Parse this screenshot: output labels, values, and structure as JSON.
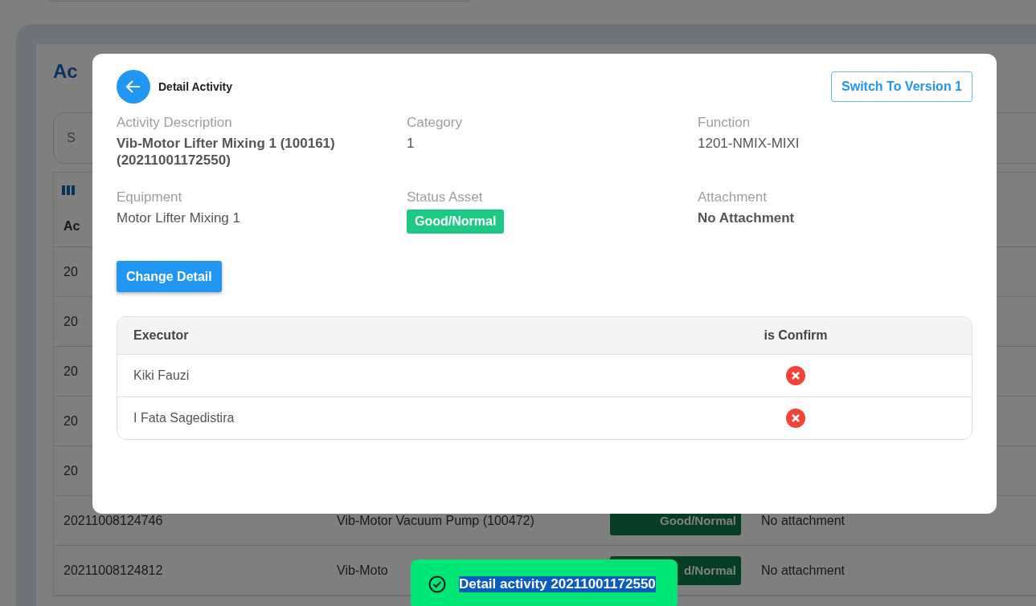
{
  "background": {
    "title": "Ac",
    "search": {
      "placeholder": "S"
    },
    "table": {
      "columns": [
        "Ac"
      ],
      "rows": [
        {
          "id": "20"
        },
        {
          "id": "20"
        },
        {
          "id": "20"
        },
        {
          "id": "20"
        },
        {
          "id": "20"
        },
        {
          "id": "20211008124746",
          "description": "Vib-Motor Vacuum Pump (100472)",
          "status": "Good/Normal",
          "attachment": "No attachment"
        },
        {
          "id": "20211008124812",
          "description": "Vib-Moto",
          "status": "d/Normal",
          "attachment": "No attachment"
        }
      ]
    }
  },
  "modal": {
    "title": "Detail Activity",
    "switch_button": "Switch To Version 1",
    "fields": [
      {
        "label": "Activity Description",
        "value": "Vib-Motor Lifter Mixing 1 (100161) (20211001172550)",
        "kind": "bold"
      },
      {
        "label": "Category",
        "value": "1",
        "kind": "text"
      },
      {
        "label": "Function",
        "value": "1201-NMIX-MIXI",
        "kind": "text"
      },
      {
        "label": "Equipment",
        "value": "Motor Lifter Mixing 1",
        "kind": "text"
      },
      {
        "label": "Status Asset",
        "value": "Good/Normal",
        "kind": "badge"
      },
      {
        "label": "Attachment",
        "value": "No Attachment",
        "kind": "bold"
      }
    ],
    "change_button": "Change Detail",
    "table": {
      "columns": [
        "Executor",
        "is Confirm"
      ],
      "rows": [
        {
          "executor": "Kiki Fauzi",
          "confirmed": false
        },
        {
          "executor": "I Fata Sagedistira",
          "confirmed": false
        }
      ]
    }
  },
  "toast": {
    "message": "Detail activity 20211001172550"
  }
}
